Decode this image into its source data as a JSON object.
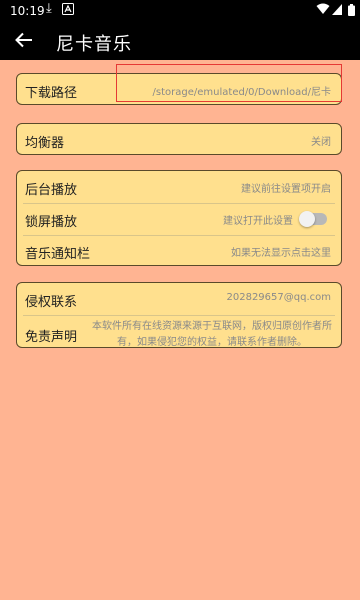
{
  "status_bar": {
    "time": "10:19",
    "icons": [
      "download-icon",
      "a-icon",
      "wifi-icon",
      "signal-icon",
      "battery-icon"
    ]
  },
  "app_bar": {
    "title": "尼卡音乐",
    "back_icon": "arrow-left-icon"
  },
  "download_path": {
    "label": "下载路径",
    "value": "/storage/emulated/0/Download/尼卡"
  },
  "equalizer": {
    "label": "均衡器",
    "value": "关闭"
  },
  "playback_group": [
    {
      "label": "后台播放",
      "value": "建议前往设置项开启"
    },
    {
      "label": "锁屏播放",
      "value": "建议打开此设置",
      "toggle_on": false
    },
    {
      "label": "音乐通知栏",
      "value": "如果无法显示点击这里"
    }
  ],
  "info_group": {
    "copyright_label": "侵权联系",
    "copyright_value": "202829657@qq.com",
    "disclaimer_label": "免责声明",
    "disclaimer_text": "本软件所有在线资源来源于互联网，版权归原创作者所有，如果侵犯您的权益，请联系作者删除。"
  },
  "colors": {
    "background": "#FFB492",
    "card": "#FFE08E",
    "highlight": "#E53935"
  }
}
